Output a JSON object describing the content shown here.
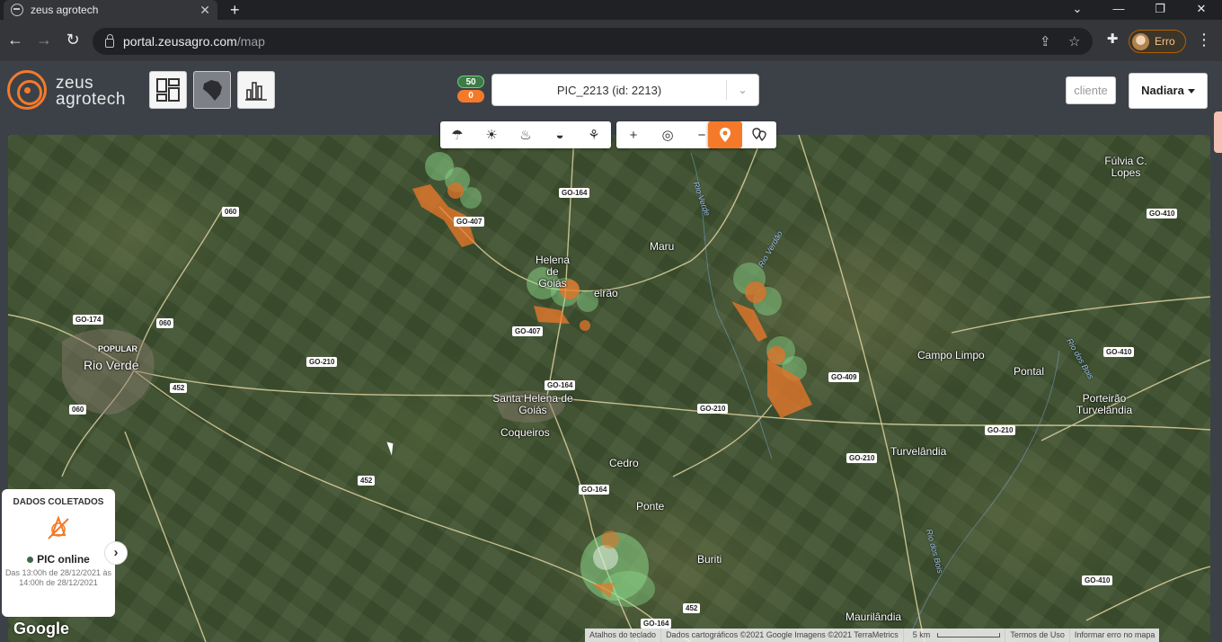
{
  "browser": {
    "tab_title": "zeus agrotech",
    "url_host": "portal.zeusagro.com",
    "url_path": "/map",
    "profile_label": "Erro",
    "new_tab": "+",
    "close_tab": "✕",
    "win_min": "⌄",
    "win_minimize": "—",
    "win_restore": "❐",
    "win_close": "✕"
  },
  "logo": {
    "line1": "zeus",
    "line2": "agrotech"
  },
  "header": {
    "count_online": "50",
    "count_offline": "0",
    "selected_device": "PIC_2213 (id: 2213)",
    "client_placeholder": "cliente",
    "user_name": "Nadiara"
  },
  "colors": {
    "accent": "#f47a2a",
    "online": "#6bd07a",
    "header_bg": "#3c4148"
  },
  "map_tools": {
    "layers": [
      "cloud-rain-icon",
      "sun-icon",
      "fire-icon",
      "sunset-icon",
      "plant-icon"
    ],
    "zoom_in": "+",
    "locate": "◎",
    "zoom_out": "−"
  },
  "places": {
    "rio_verde": "Rio Verde",
    "popular": "POPULAR",
    "helena": "Helena de Goiás",
    "maru": "Maru",
    "heirao": "eirão",
    "santa_helena": "Santa Helena de Goiás",
    "coqueiros": "Coqueiros",
    "cedro": "Cedro",
    "ponte": "Ponte",
    "buriti": "Buriti",
    "campo_limpo": "Campo Limpo",
    "pontal": "Pontal",
    "porteirao": "Porteirão Turvelândia",
    "turvelandia": "Turvelândia",
    "fulvia": "Fúlvia C. Lopes",
    "maurilandia": "Maurilândia"
  },
  "roads": {
    "r060a": "060",
    "r060b": "060",
    "r060c": "060",
    "go174": "GO-174",
    "r452a": "452",
    "r452b": "452",
    "r452c": "452",
    "go210a": "GO-210",
    "go210b": "GO-210",
    "go210c": "GO-210",
    "go210d": "GO-210",
    "go164a": "GO-164",
    "go164b": "GO-164",
    "go164c": "GO-164",
    "go164d": "GO-164",
    "go407a": "GO-407",
    "go407b": "GO-407",
    "go409": "GO-409",
    "go410a": "GO-410",
    "go410b": "GO-410",
    "go410c": "GO-410"
  },
  "rivers": {
    "rio_verde": "Rio Verde",
    "rio_verdao": "Rio Verdão",
    "rio_dos_bois": "Rio dos Bois",
    "rio_dos_bois2": "Rio dos Bois"
  },
  "card": {
    "heading": "DADOS COLETADOS",
    "status": "PIC online",
    "detail": "Das 13:00h de 28/12/2021 às 14:00h de 28/12/2021",
    "next": "›"
  },
  "map_footer": {
    "google": "Google",
    "shortcuts": "Atalhos do teclado",
    "data": "Dados cartográficos ©2021 Google Imagens ©2021 TerraMetrics",
    "scale": "5 km",
    "terms": "Termos de Uso",
    "report": "Informar erro no mapa"
  }
}
